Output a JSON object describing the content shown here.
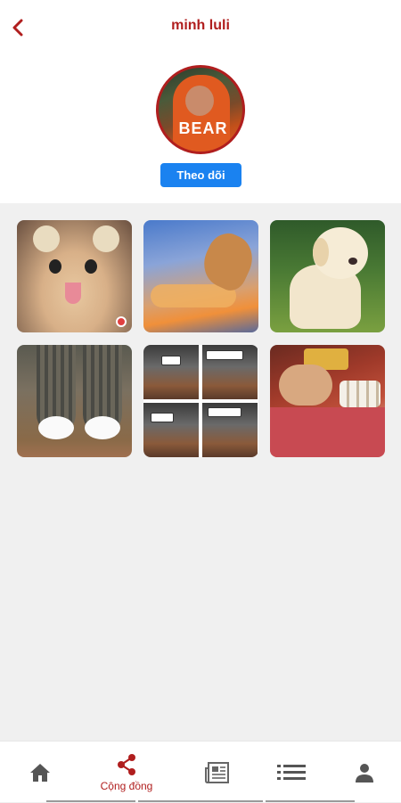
{
  "header": {
    "title": "minh luli",
    "back_icon": "chevron-left-icon",
    "follow_label": "Theo dõi",
    "avatar_text": "BEAR"
  },
  "colors": {
    "brand_red": "#b01e1e",
    "follow_blue": "#1a82f0",
    "background": "#f0f0f0"
  },
  "gallery": {
    "items": [
      {
        "name": "cat-with-hat-photo"
      },
      {
        "name": "cat-in-sky-photo"
      },
      {
        "name": "puppy-photo"
      },
      {
        "name": "cat-paws-photo"
      },
      {
        "name": "comic-strip-photo"
      },
      {
        "name": "altar-offering-photo"
      }
    ]
  },
  "bottom_nav": {
    "items": [
      {
        "icon": "home-icon",
        "label": ""
      },
      {
        "icon": "share-icon",
        "label": "Cộng đồng",
        "active": true
      },
      {
        "icon": "newspaper-icon",
        "label": ""
      },
      {
        "icon": "list-icon",
        "label": ""
      },
      {
        "icon": "person-icon",
        "label": ""
      }
    ]
  }
}
